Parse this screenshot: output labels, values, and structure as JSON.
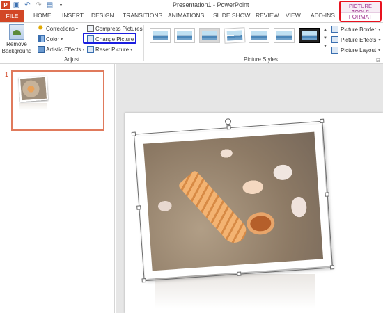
{
  "window": {
    "title": "Presentation1 - PowerPoint"
  },
  "qat": {
    "icons": [
      "powerpoint-app-icon",
      "save-icon",
      "undo-icon",
      "redo-icon",
      "from-beginning-icon",
      "customize-qat-icon"
    ]
  },
  "tabs": {
    "file": "FILE",
    "home": "HOME",
    "insert": "INSERT",
    "design": "DESIGN",
    "transitions": "TRANSITIONS",
    "animations": "ANIMATIONS",
    "slideshow": "SLIDE SHOW",
    "review": "REVIEW",
    "view": "VIEW",
    "addins": "ADD-INS"
  },
  "contextual": {
    "title": "PICTURE TOOLS",
    "format": "FORMAT"
  },
  "ribbon": {
    "adjust": {
      "remove_bg_line1": "Remove",
      "remove_bg_line2": "Background",
      "corrections": "Corrections",
      "color": "Color",
      "artistic": "Artistic Effects",
      "compress": "Compress Pictures",
      "change": "Change Picture",
      "reset": "Reset Picture",
      "label": "Adjust"
    },
    "styles": {
      "label": "Picture Styles"
    },
    "right": {
      "border": "Picture Border",
      "effects": "Picture Effects",
      "layout": "Picture Layout"
    }
  },
  "slides_pane": {
    "slide_number": "1"
  },
  "colors": {
    "accent": "#d24726",
    "contextual": "#9b2a8a",
    "highlight_red": "#e8121f",
    "highlight_blue": "#1a1de0"
  }
}
